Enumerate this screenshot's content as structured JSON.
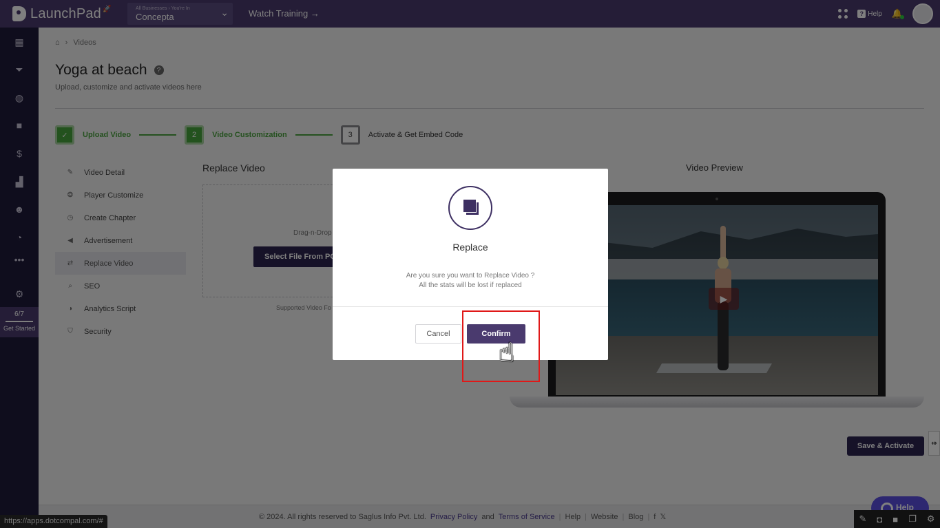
{
  "app": {
    "name": "LaunchPad"
  },
  "header": {
    "business_caption": "All Businesses › You're In",
    "business_name": "Concepta",
    "watch_training": "Watch Training →",
    "help_label": "Help"
  },
  "sidebar": {
    "get_started_progress": "6/7",
    "get_started_label": "Get Started"
  },
  "breadcrumb": {
    "current": "Videos"
  },
  "page": {
    "title": "Yoga at beach",
    "subtitle": "Upload, customize and activate videos here"
  },
  "stepper": [
    {
      "number": "✓",
      "label": "Upload Video",
      "state": "done"
    },
    {
      "number": "2",
      "label": "Video Customization",
      "state": "done"
    },
    {
      "number": "3",
      "label": "Activate & Get Embed Code",
      "state": "current"
    }
  ],
  "subnav": [
    {
      "label": "Video Detail",
      "icon": "edit-icon"
    },
    {
      "label": "Player Customize",
      "icon": "palette-icon"
    },
    {
      "label": "Create Chapter",
      "icon": "timer-icon"
    },
    {
      "label": "Advertisement",
      "icon": "megaphone-icon"
    },
    {
      "label": "Replace Video",
      "icon": "swap-icon",
      "active": true
    },
    {
      "label": "SEO",
      "icon": "search-icon"
    },
    {
      "label": "Analytics Script",
      "icon": "analytics-icon"
    },
    {
      "label": "Security",
      "icon": "shield-icon"
    }
  ],
  "replace": {
    "title": "Replace Video",
    "drop_text": "Drag-n-Drop",
    "select_button": "Select File From PC",
    "supported_text": "Supported Video Fo"
  },
  "preview": {
    "title": "Video Preview"
  },
  "actions": {
    "save_activate": "Save & Activate"
  },
  "modal": {
    "title": "Replace",
    "message_line1": "Are you sure you want to Replace Video ?",
    "message_line2": "All the stats will be lost if replaced",
    "cancel_label": "Cancel",
    "confirm_label": "Confirm"
  },
  "footer": {
    "copyright": "©  2024. All rights reserved to Saglus Info Pvt. Ltd.",
    "privacy": "Privacy Policy",
    "and": "and",
    "terms": "Terms of Service",
    "help": "Help",
    "website": "Website",
    "blog": "Blog"
  },
  "status_bar": {
    "url": "https://apps.dotcompal.com/#"
  },
  "help_float": {
    "label": "Help"
  },
  "colors": {
    "primary": "#4a3a6e",
    "sidebar": "#1f1a3a",
    "success": "#46a53c",
    "highlight": "#e01818"
  }
}
